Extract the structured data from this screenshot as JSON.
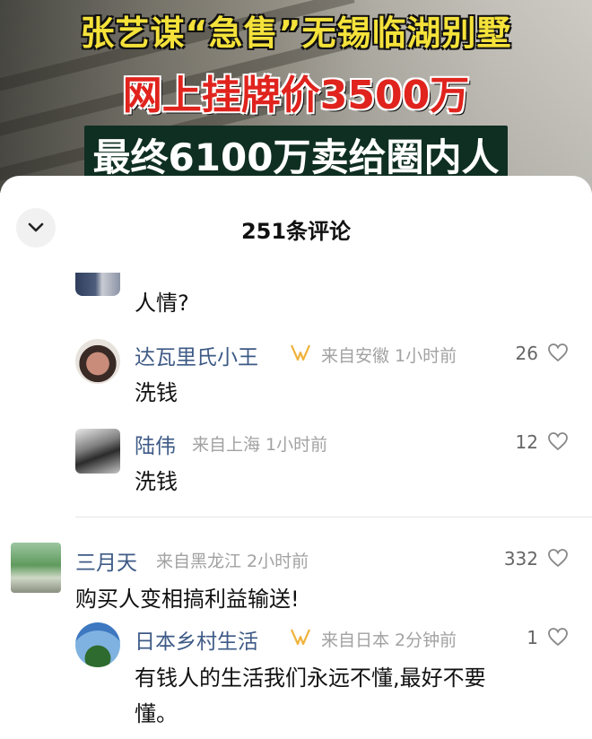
{
  "cover": {
    "line1": "张艺谋“急售”无锡临湖别墅",
    "line2": "网上挂牌价3500万",
    "line3": "最终6100万卖给圈内人"
  },
  "sheet": {
    "title": "251条评论",
    "collapse_icon": "chevron-down-icon"
  },
  "comments": [
    {
      "text": "人情?"
    },
    {
      "name": "达瓦里氏小王",
      "badge": "vip-badge-icon",
      "meta": "来自安徽 1小时前",
      "likes": "26",
      "text": "洗钱"
    },
    {
      "name": "陆伟",
      "meta": "来自上海 1小时前",
      "likes": "12",
      "text": "洗钱"
    },
    {
      "name": "三月天",
      "meta": "来自黑龙江 2小时前",
      "likes": "332",
      "text": "购买人变相搞利益输送!"
    },
    {
      "name": "日本乡村生活",
      "badge": "vip-badge-icon",
      "meta": "来自日本 2分钟前",
      "likes": "1",
      "text_line1": "有钱人的生活我们永远不懂,最好不要",
      "text_line2": "懂。"
    }
  ],
  "colors": {
    "username": "#3d5a86",
    "meta": "#a2a2a2",
    "badge": "#f0b33c"
  }
}
